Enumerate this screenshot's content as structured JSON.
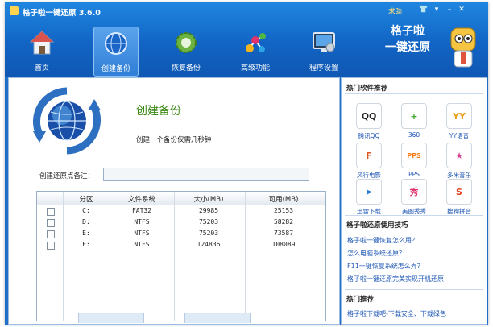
{
  "window": {
    "title": "格子啦一键还原 3.6.0",
    "help": "求助"
  },
  "toolbar": {
    "items": [
      {
        "label": "首页",
        "icon": "home-icon"
      },
      {
        "label": "创建备份",
        "icon": "globe-backup-icon",
        "active": true
      },
      {
        "label": "恢复备份",
        "icon": "gear-refresh-icon"
      },
      {
        "label": "高级功能",
        "icon": "molecule-icon"
      },
      {
        "label": "程序设置",
        "icon": "monitor-settings-icon"
      }
    ],
    "brand_line1": "格子啦",
    "brand_line2": "一键还原"
  },
  "main": {
    "title": "创建备份",
    "description": "创建一个备份仅需几秒钟",
    "note_label": "创建还原点备注：",
    "note_value": "",
    "table": {
      "headers": [
        "分区",
        "文件系统",
        "大小(MB)",
        "可用(MB)"
      ],
      "rows": [
        {
          "drive": "C:",
          "fs": "FAT32",
          "size": "29985",
          "free": "25153"
        },
        {
          "drive": "D:",
          "fs": "NTFS",
          "size": "75203",
          "free": "58282"
        },
        {
          "drive": "E:",
          "fs": "NTFS",
          "size": "75203",
          "free": "73587"
        },
        {
          "drive": "F:",
          "fs": "NTFS",
          "size": "124836",
          "free": "108089"
        }
      ]
    }
  },
  "sidebar": {
    "hot_software_title": "热门软件推荐",
    "software": [
      {
        "label": "腾讯QQ",
        "icon": "qq-icon",
        "glyph": "QQ",
        "color": "#222222"
      },
      {
        "label": "360",
        "icon": "360-icon",
        "glyph": "+",
        "color": "#3aa829"
      },
      {
        "label": "YY语音",
        "icon": "yy-icon",
        "glyph": "YY",
        "color": "#e8a21a"
      },
      {
        "label": "风行电影",
        "icon": "funshion-icon",
        "glyph": "F",
        "color": "#e2531d"
      },
      {
        "label": "PPS",
        "icon": "pps-icon",
        "glyph": "PPS",
        "color": "#f07a12"
      },
      {
        "label": "多米音乐",
        "icon": "duomi-icon",
        "glyph": "★",
        "color": "#d63c8c"
      },
      {
        "label": "迅雷下载",
        "icon": "xunlei-icon",
        "glyph": "➤",
        "color": "#2a7bd0"
      },
      {
        "label": "美图秀秀",
        "icon": "meitu-icon",
        "glyph": "秀",
        "color": "#e0336d"
      },
      {
        "label": "搜狗拼音",
        "icon": "sogou-icon",
        "glyph": "S",
        "color": "#e2441d"
      }
    ],
    "tips_title": "格子啦还原使用技巧",
    "tips": [
      "格子啦一键恢复怎么用？",
      "怎么电脑系统还原？",
      "F11一键恢复系统怎么弄？",
      "格子啦一键还原完美实现开机还原"
    ],
    "recommend_title": "热门推荐",
    "recommend_link": "格子啦下载吧-下载安全、下载绿色"
  },
  "colors": {
    "accent": "#1d6fc9",
    "title_green": "#3c8a16",
    "link": "#1f57b5"
  }
}
